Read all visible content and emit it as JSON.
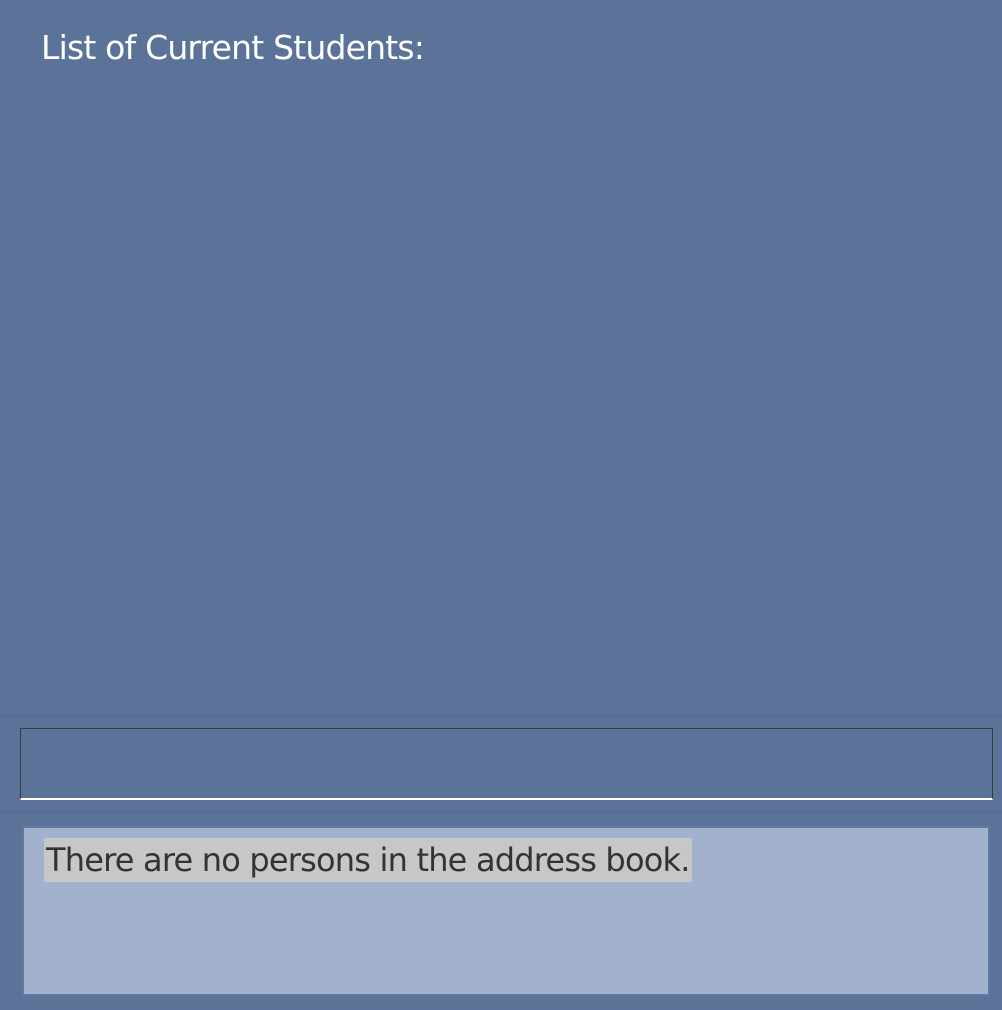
{
  "student_list": {
    "title": "List of Current Students:",
    "items": []
  },
  "command": {
    "value": "",
    "placeholder": ""
  },
  "result": {
    "message": "There are no persons in the address book."
  },
  "colors": {
    "background": "#5b7399",
    "result_box": "#a2b1cc",
    "highlight": "#c7c7c7",
    "title_text": "#ffffff",
    "result_text": "#333333"
  }
}
